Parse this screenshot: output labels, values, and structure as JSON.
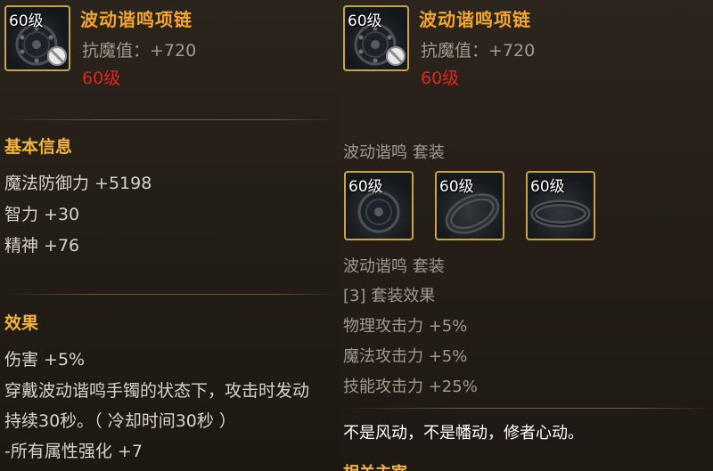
{
  "left": {
    "item": {
      "level_badge": "60级",
      "name": "波动谐鸣项链",
      "stat": "抗魔值：+720",
      "req_level": "60级",
      "icon": "necklace-icon",
      "lock_icon": "no-trade-icon"
    },
    "basic_info": {
      "heading": "基本信息",
      "stats": [
        "魔法防御力 +5198",
        "智力 +30",
        "精神 +76"
      ]
    },
    "effect": {
      "heading": "效果",
      "lines": [
        "伤害 +5%",
        "穿戴波动谐鸣手镯的状态下，攻击时发动",
        "持续30秒。（ 冷却时间30秒 ）",
        "-所有属性强化 +7"
      ]
    }
  },
  "right": {
    "item": {
      "level_badge": "60级",
      "name": "波动谐鸣项链",
      "stat": "抗魔值：+720",
      "req_level": "60级"
    },
    "set": {
      "title": "波动谐鸣  套装",
      "pieces": [
        {
          "level": "60级",
          "icon": "necklace-icon"
        },
        {
          "level": "60级",
          "icon": "bracelet-icon"
        },
        {
          "level": "60级",
          "icon": "ring-icon"
        }
      ],
      "title2": "波动谐鸣  套装",
      "bonus_heading": "[3] 套装效果",
      "bonuses": [
        "物理攻击力 +5%",
        "魔法攻击力 +5%",
        "技能攻击力 +25%"
      ],
      "flavor": "不是风动，不是幡动，修者心动。",
      "footer_partial": "相关主宰"
    }
  },
  "colors": {
    "accent": "#f3a52f",
    "border": "#c9a24a",
    "red": "#e3241f",
    "text": "#d8d3c8",
    "gray": "#9f998e"
  }
}
